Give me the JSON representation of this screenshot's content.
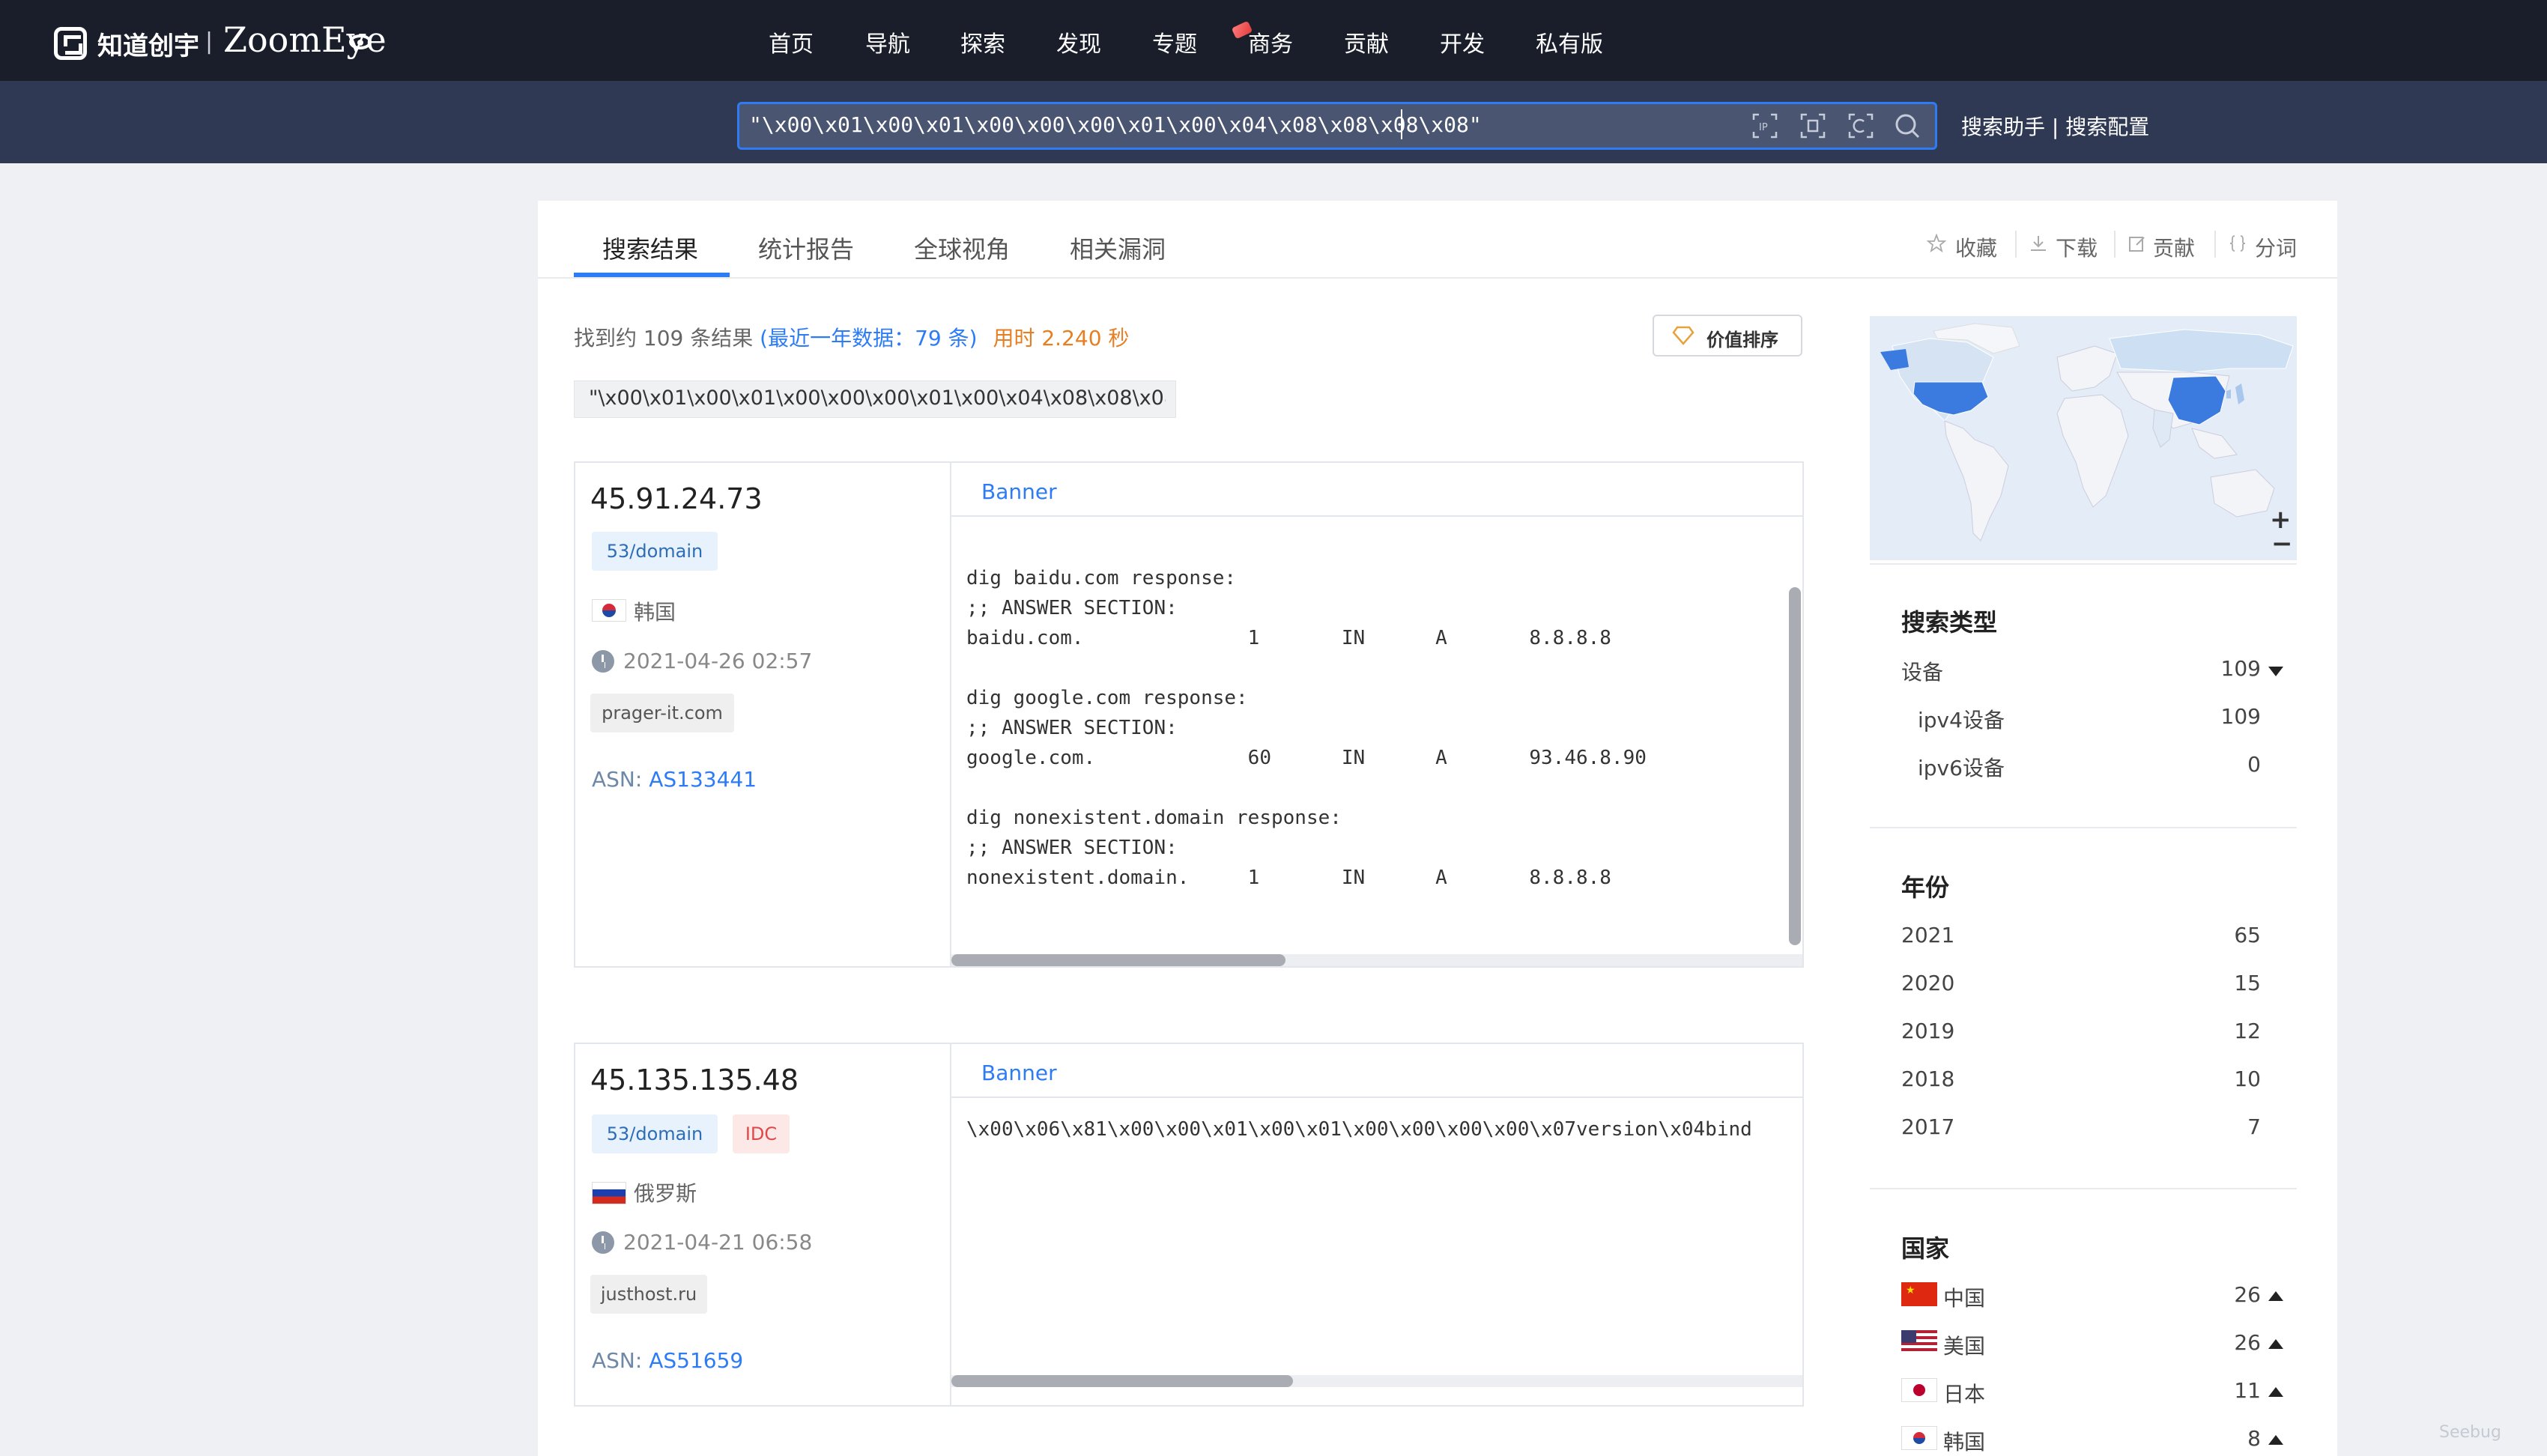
{
  "header": {
    "logo_cn": "知道创宇",
    "logo_sep": "|",
    "logo_en": "ZoomEye",
    "nav": [
      "首页",
      "导航",
      "探索",
      "发现",
      "专题",
      "商务",
      "贡献",
      "开发",
      "私有版"
    ]
  },
  "search": {
    "query": "\"\\x00\\x01\\x00\\x01\\x00\\x00\\x00\\x01\\x00\\x04\\x08\\x08\\x08\\x08\"",
    "links": "搜索助手 | 搜索配置",
    "icons": [
      "ip-search-icon",
      "domain-search-icon",
      "image-search-icon",
      "search-icon"
    ]
  },
  "tabs": [
    "搜索结果",
    "统计报告",
    "全球视角",
    "相关漏洞"
  ],
  "tools": [
    "收藏",
    "下载",
    "贡献",
    "分词"
  ],
  "summary": {
    "found": "找到约 109 条结果",
    "recent": "(最近一年数据：79 条)",
    "time": "用时 2.240 秒",
    "sort_label": "价值排序"
  },
  "query_chip": "\"\\x00\\x01\\x00\\x01\\x00\\x00\\x00\\x01\\x00\\x04\\x08\\x08\\x08\\x...",
  "results": [
    {
      "ip": "45.91.24.73",
      "port_tag": "53/domain",
      "country": "韩国",
      "date": "2021-04-26 02:57",
      "host": "prager-it.com",
      "asn_label": "ASN:",
      "asn": "AS133441",
      "banner_title": "Banner",
      "banner": "\ndig baidu.com response:\n;; ANSWER SECTION:\nbaidu.com.              1       IN      A       8.8.8.8\n\ndig google.com response:\n;; ANSWER SECTION:\ngoogle.com.             60      IN      A       93.46.8.90\n\ndig nonexistent.domain response:\n;; ANSWER SECTION:\nnonexistent.domain.     1       IN      A       8.8.8.8"
    },
    {
      "ip": "45.135.135.48",
      "port_tag": "53/domain",
      "extra_tag": "IDC",
      "country": "俄罗斯",
      "date": "2021-04-21 06:58",
      "host": "justhost.ru",
      "asn_label": "ASN:",
      "asn": "AS51659",
      "banner_title": "Banner",
      "banner": "\\x00\\x06\\x81\\x00\\x00\\x01\\x00\\x01\\x00\\x00\\x00\\x00\\x07version\\x04bind"
    }
  ],
  "sidebar": {
    "search_type": {
      "title": "搜索类型",
      "rows": [
        {
          "label": "设备",
          "count": "109"
        },
        {
          "label": "ipv4设备",
          "count": "109"
        },
        {
          "label": "ipv6设备",
          "count": "0"
        }
      ]
    },
    "year": {
      "title": "年份",
      "rows": [
        {
          "label": "2021",
          "count": "65"
        },
        {
          "label": "2020",
          "count": "15"
        },
        {
          "label": "2019",
          "count": "12"
        },
        {
          "label": "2018",
          "count": "10"
        },
        {
          "label": "2017",
          "count": "7"
        }
      ]
    },
    "country": {
      "title": "国家",
      "rows": [
        {
          "label": "中国",
          "count": "26"
        },
        {
          "label": "美国",
          "count": "26"
        },
        {
          "label": "日本",
          "count": "11"
        },
        {
          "label": "韩国",
          "count": "8"
        }
      ]
    },
    "map_zoom": [
      "+",
      "−"
    ]
  },
  "colors": {
    "accent": "#2d7cf6",
    "topbar": "#191e2a",
    "searchbar": "#2f3953",
    "map_highlight": "#3b7be0"
  },
  "watermark": "Seebug"
}
